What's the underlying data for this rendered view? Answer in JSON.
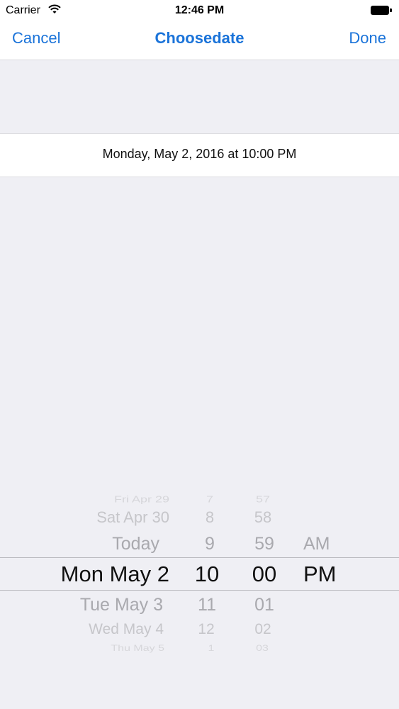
{
  "status_bar": {
    "carrier": "Carrier",
    "time": "12:46 PM"
  },
  "nav": {
    "cancel_label": "Cancel",
    "title": "Choosedate",
    "done_label": "Done"
  },
  "selected_date_text": "Monday, May 2, 2016 at 10:00 PM",
  "picker": {
    "dates": [
      "Fri Apr 29",
      "Sat Apr 30",
      "Today",
      "Mon May 2",
      "Tue May 3",
      "Wed May 4",
      "Thu May 5"
    ],
    "hours": [
      "7",
      "8",
      "9",
      "10",
      "11",
      "12",
      "1"
    ],
    "minutes": [
      "57",
      "58",
      "59",
      "00",
      "01",
      "02",
      "03"
    ],
    "ampm": [
      "AM",
      "PM"
    ],
    "selected": {
      "date": "Mon May 2",
      "hour": "10",
      "minute": "00",
      "ampm": "PM"
    }
  },
  "colors": {
    "accent": "#1a73d9",
    "background": "#efeff4"
  }
}
